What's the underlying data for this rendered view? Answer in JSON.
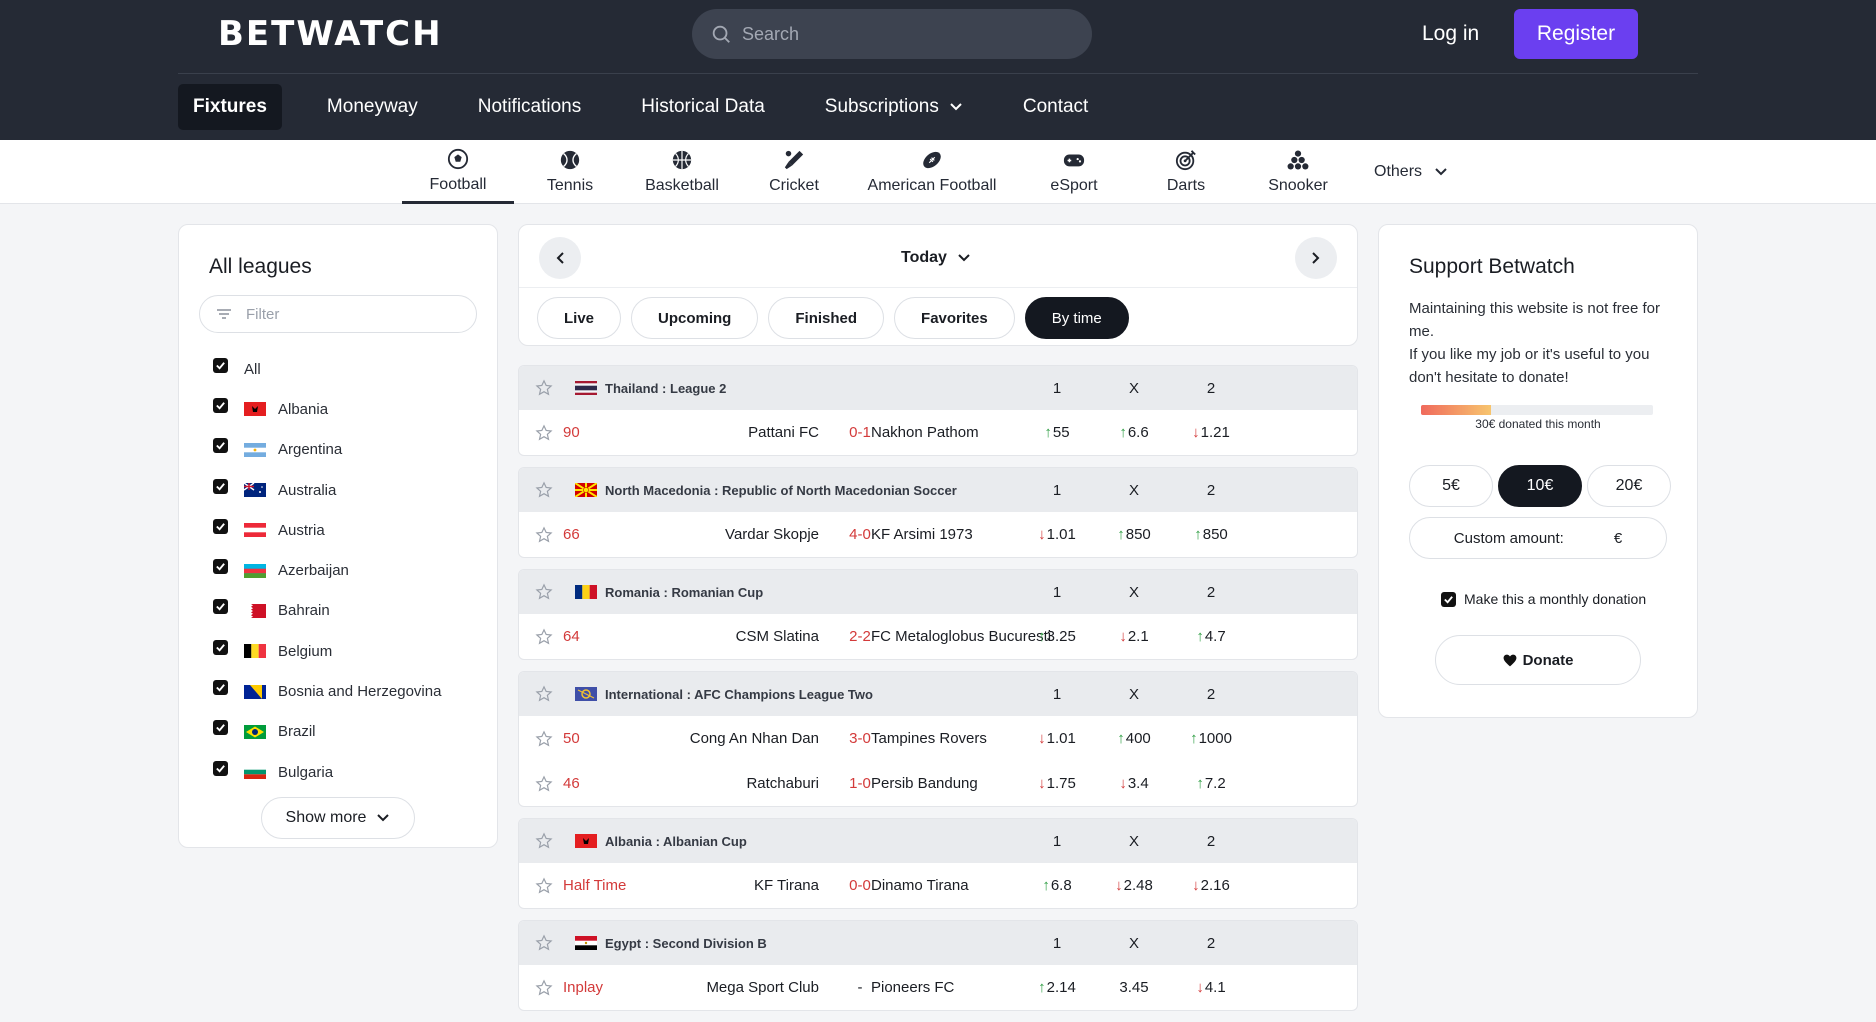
{
  "header": {
    "logo": "BETWATCH",
    "search_placeholder": "Search",
    "login": "Log in",
    "register": "Register"
  },
  "nav": [
    {
      "label": "Fixtures",
      "active": true
    },
    {
      "label": "Moneyway"
    },
    {
      "label": "Notifications"
    },
    {
      "label": "Historical Data"
    },
    {
      "label": "Subscriptions"
    },
    {
      "label": "Contact"
    }
  ],
  "sports": [
    {
      "label": "Football",
      "icon": "football-icon",
      "active": true
    },
    {
      "label": "Tennis",
      "icon": "tennis-icon"
    },
    {
      "label": "Basketball",
      "icon": "basketball-icon"
    },
    {
      "label": "Cricket",
      "icon": "cricket-icon"
    },
    {
      "label": "American Football",
      "icon": "american-football-icon"
    },
    {
      "label": "eSport",
      "icon": "gamepad-icon"
    },
    {
      "label": "Darts",
      "icon": "darts-icon"
    },
    {
      "label": "Snooker",
      "icon": "snooker-icon"
    }
  ],
  "others": "Others",
  "leagues_panel": {
    "title": "All leagues",
    "filter_placeholder": "Filter",
    "items": [
      {
        "label": "All",
        "flag": ""
      },
      {
        "label": "Albania",
        "flag": "albania"
      },
      {
        "label": "Argentina",
        "flag": "argentina"
      },
      {
        "label": "Australia",
        "flag": "australia"
      },
      {
        "label": "Austria",
        "flag": "austria"
      },
      {
        "label": "Azerbaijan",
        "flag": "azerbaijan"
      },
      {
        "label": "Bahrain",
        "flag": "bahrain"
      },
      {
        "label": "Belgium",
        "flag": "belgium"
      },
      {
        "label": "Bosnia and Herzegovina",
        "flag": "bosnia"
      },
      {
        "label": "Brazil",
        "flag": "brazil"
      },
      {
        "label": "Bulgaria",
        "flag": "bulgaria"
      }
    ],
    "show_more": "Show more"
  },
  "date_nav": {
    "label": "Today"
  },
  "filter_tabs": [
    {
      "label": "Live"
    },
    {
      "label": "Upcoming"
    },
    {
      "label": "Finished"
    },
    {
      "label": "Favorites"
    },
    {
      "label": "By time",
      "active": true
    }
  ],
  "columns": {
    "one": "1",
    "x": "X",
    "two": "2"
  },
  "fixtures": [
    {
      "league": "Thailand : League 2",
      "flag": "thailand",
      "matches": [
        {
          "minute": "90",
          "home": "Pattani FC",
          "score": "0-1",
          "away": "Nakhon Pathom",
          "odds": [
            {
              "v": "55",
              "d": "up"
            },
            {
              "v": "6.6",
              "d": "up"
            },
            {
              "v": "1.21",
              "d": "down"
            }
          ]
        }
      ]
    },
    {
      "league": "North Macedonia : Republic of North Macedonian Soccer",
      "flag": "macedonia",
      "matches": [
        {
          "minute": "66",
          "home": "Vardar Skopje",
          "score": "4-0",
          "away": "KF Arsimi 1973",
          "odds": [
            {
              "v": "1.01",
              "d": "down"
            },
            {
              "v": "850",
              "d": "up"
            },
            {
              "v": "850",
              "d": "up"
            }
          ]
        }
      ]
    },
    {
      "league": "Romania : Romanian Cup",
      "flag": "romania",
      "matches": [
        {
          "minute": "64",
          "home": "CSM Slatina",
          "score": "2-2",
          "away": "FC Metaloglobus Bucuresti",
          "odds": [
            {
              "v": "3.25",
              "d": "up"
            },
            {
              "v": "2.1",
              "d": "down"
            },
            {
              "v": "4.7",
              "d": "up"
            }
          ]
        }
      ]
    },
    {
      "league": "International : AFC Champions League Two",
      "flag": "international",
      "matches": [
        {
          "minute": "50",
          "home": "Cong An Nhan Dan",
          "score": "3-0",
          "away": "Tampines Rovers",
          "odds": [
            {
              "v": "1.01",
              "d": "down"
            },
            {
              "v": "400",
              "d": "up"
            },
            {
              "v": "1000",
              "d": "up"
            }
          ]
        },
        {
          "minute": "46",
          "home": "Ratchaburi",
          "score": "1-0",
          "away": "Persib Bandung",
          "odds": [
            {
              "v": "1.75",
              "d": "down"
            },
            {
              "v": "3.4",
              "d": "down"
            },
            {
              "v": "7.2",
              "d": "up"
            }
          ]
        }
      ]
    },
    {
      "league": "Albania : Albanian Cup",
      "flag": "albania",
      "matches": [
        {
          "minute": "Half Time",
          "home": "KF Tirana",
          "score": "0-0",
          "away": "Dinamo Tirana",
          "odds": [
            {
              "v": "6.8",
              "d": "up"
            },
            {
              "v": "2.48",
              "d": "down"
            },
            {
              "v": "2.16",
              "d": "down"
            }
          ]
        }
      ]
    },
    {
      "league": "Egypt : Second Division B",
      "flag": "egypt",
      "matches": [
        {
          "minute": "Inplay",
          "home": "Mega Sport Club",
          "score": "-",
          "away": "Pioneers FC",
          "odds": [
            {
              "v": "2.14",
              "d": "up"
            },
            {
              "v": "3.45",
              "d": ""
            },
            {
              "v": "4.1",
              "d": "down"
            }
          ]
        }
      ]
    }
  ],
  "support": {
    "title": "Support Betwatch",
    "text": "Maintaining this website is not free for me.\nIf you like my job or it's useful to you don't hesitate to donate!",
    "progress_fraction": 0.3,
    "donated_text": "30€ donated this month",
    "amounts": [
      {
        "label": "5€"
      },
      {
        "label": "10€",
        "active": true
      },
      {
        "label": "20€"
      }
    ],
    "custom_label": "Custom amount:",
    "custom_currency": "€",
    "monthly_label": "Make this a monthly donation",
    "donate_label": "Donate"
  },
  "colors": {
    "accent": "#6b3ff0",
    "header_bg": "#252a35",
    "up": "#2e9e43",
    "down": "#d33a3a"
  }
}
